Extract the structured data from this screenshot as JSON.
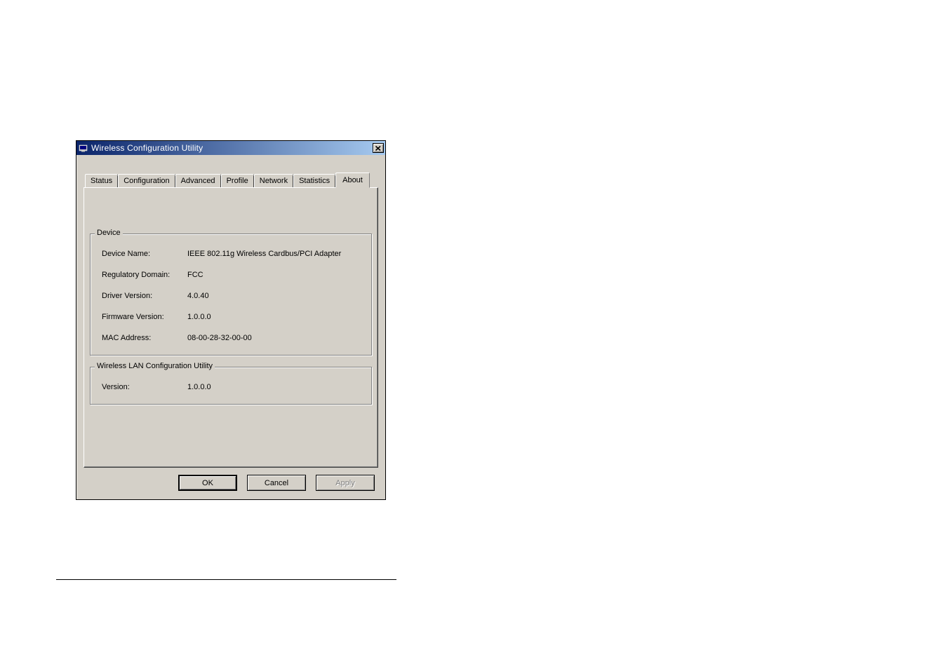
{
  "window": {
    "title": "Wireless Configuration Utility"
  },
  "tabs": [
    {
      "label": "Status"
    },
    {
      "label": "Configuration"
    },
    {
      "label": "Advanced"
    },
    {
      "label": "Profile"
    },
    {
      "label": "Network"
    },
    {
      "label": "Statistics"
    },
    {
      "label": "About",
      "active": true
    }
  ],
  "device_group": {
    "title": "Device",
    "rows": [
      {
        "label": "Device Name:",
        "value": "IEEE 802.11g Wireless Cardbus/PCI Adapter"
      },
      {
        "label": "Regulatory Domain:",
        "value": "FCC"
      },
      {
        "label": "Driver Version:",
        "value": "4.0.40"
      },
      {
        "label": "Firmware Version:",
        "value": "1.0.0.0"
      },
      {
        "label": "MAC Address:",
        "value": "08-00-28-32-00-00"
      }
    ]
  },
  "utility_group": {
    "title": "Wireless LAN Configuration Utility",
    "rows": [
      {
        "label": "Version:",
        "value": "1.0.0.0"
      }
    ]
  },
  "buttons": {
    "ok": "OK",
    "cancel": "Cancel",
    "apply": "Apply"
  }
}
